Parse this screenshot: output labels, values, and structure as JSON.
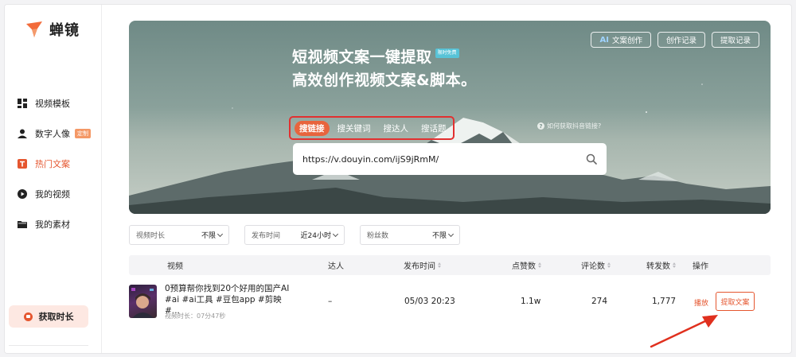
{
  "brand": {
    "name": "蝉镜"
  },
  "sidebar": {
    "items": [
      {
        "label": "视频模板",
        "icon": "grid-icon"
      },
      {
        "label": "数字人像",
        "icon": "user-icon",
        "badge": "定制"
      },
      {
        "label": "热门文案",
        "icon": "text-icon"
      },
      {
        "label": "我的视频",
        "icon": "play-icon"
      },
      {
        "label": "我的素材",
        "icon": "folder-icon"
      }
    ],
    "active_index": 2,
    "cta_label": "获取时长"
  },
  "hero": {
    "buttons": {
      "ai_prefix": "AI",
      "ai_label": "文案创作",
      "history": "创作记录",
      "extract_history": "提取记录"
    },
    "title_line1": "短视频文案一键提取",
    "free_tag": "限时免费",
    "title_line2": "高效创作视频文案&脚本。",
    "tabs": [
      "搜链接",
      "搜关键词",
      "搜达人",
      "搜话题"
    ],
    "active_tab": 0,
    "help_text": "如何获取抖音链接?",
    "search_value": "https://v.douyin.com/ijS9jRmM/"
  },
  "filters": [
    {
      "label": "视频时长",
      "value": "不限"
    },
    {
      "label": "发布时间",
      "value": "近24小时"
    },
    {
      "label": "粉丝数",
      "value": "不限"
    }
  ],
  "table": {
    "headers": {
      "video": "视频",
      "creator": "达人",
      "publish_time": "发布时间",
      "likes": "点赞数",
      "comments": "评论数",
      "shares": "转发数",
      "actions": "操作"
    },
    "rows": [
      {
        "title": "0预算帮你找到20个好用的国产AI #ai #ai工具 #豆包app #剪映 #...",
        "duration": "视频时长：07分47秒",
        "creator": "–",
        "publish_time": "05/03 20:23",
        "likes": "1.1w",
        "comments": "274",
        "shares": "1,777",
        "play_label": "播放",
        "extract_label": "提取文案"
      }
    ]
  },
  "colors": {
    "accent": "#e5562f",
    "highlight_box": "#e23030",
    "arrow": "#e0301e"
  }
}
